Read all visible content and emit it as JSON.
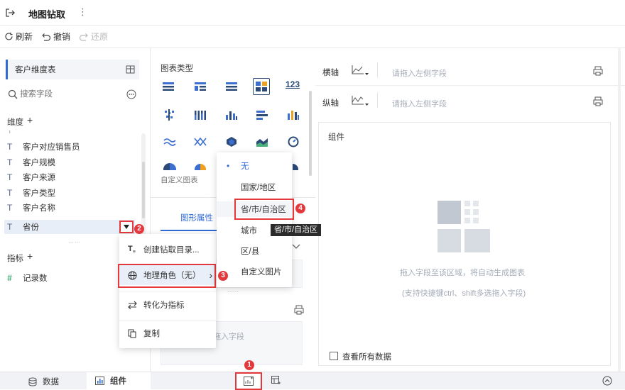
{
  "titlebar": {
    "title": "地图钻取",
    "more": "⋮"
  },
  "toolbar": {
    "refresh": "刷新",
    "undo": "撤销",
    "redo": "还原"
  },
  "left": {
    "table_name": "客户维度表",
    "search_placeholder": "搜索字段",
    "dim_header": "维度",
    "dim_add": "+",
    "fields": [
      "客户对应销售员",
      "客户规模",
      "客户来源",
      "客户类型",
      "客户名称",
      "省份"
    ],
    "measure_header": "指标",
    "measure_add": "+",
    "measures": [
      "记录数"
    ]
  },
  "context_menu": {
    "items": [
      "创建钻取目录...",
      "地理角色（无）",
      "转化为指标",
      "复制"
    ],
    "arrow": "›"
  },
  "middle": {
    "chart_type_label": "图表类型",
    "custom_chart": "自定义图表",
    "tab_active": "图形属性",
    "drag_hint": "拖入字段"
  },
  "geo_menu": {
    "items": [
      "无",
      "国家/地区",
      "省/市/自治区",
      "城市",
      "区/县",
      "自定义图片"
    ],
    "selected": "无"
  },
  "tooltip": "省/市/自治区",
  "right": {
    "x_axis": "横轴",
    "y_axis": "纵轴",
    "x_placeholder": "请拖入左侧字段",
    "y_placeholder": "请拖入左侧字段",
    "component_label": "组件",
    "hint1": "拖入字段至该区域，将自动生成图表",
    "hint2": "(支持快捷键ctrl、shift多选拖入字段)",
    "show_all": "查看所有数据"
  },
  "bottom": {
    "tab_data": "数据",
    "tab_component": "组件"
  },
  "badges": [
    "1",
    "2",
    "3",
    "4"
  ],
  "colors": {
    "accent": "#2f6bd6",
    "red": "#e4393c",
    "chart_blue": "#3c6fd0",
    "chart_green": "#49b07a"
  }
}
